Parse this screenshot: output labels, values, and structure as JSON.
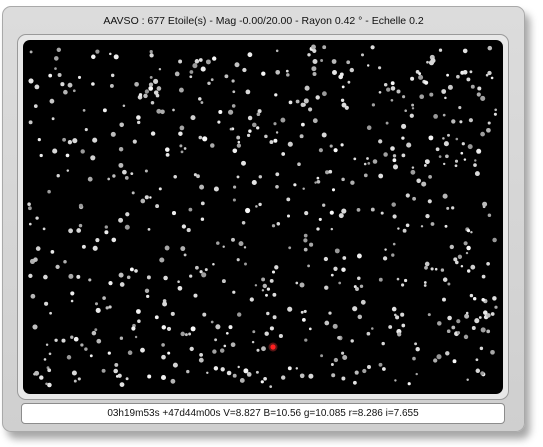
{
  "header": {
    "title": "AAVSO : 677 Etoile(s) - Mag -0.00/20.00 - Rayon 0.42 ° - Echelle 0.2"
  },
  "star_map": {
    "star_count": 677,
    "highlighted_star": "red marker near center",
    "colors": {
      "sky": "#000000",
      "star": "#d8d8d8",
      "highlight": "#ff2020"
    }
  },
  "status_bar": {
    "text": "03h19m53s +47d44m00s V=8.827 B=10.56 g=10.085 r=8.286 i=7.655"
  }
}
